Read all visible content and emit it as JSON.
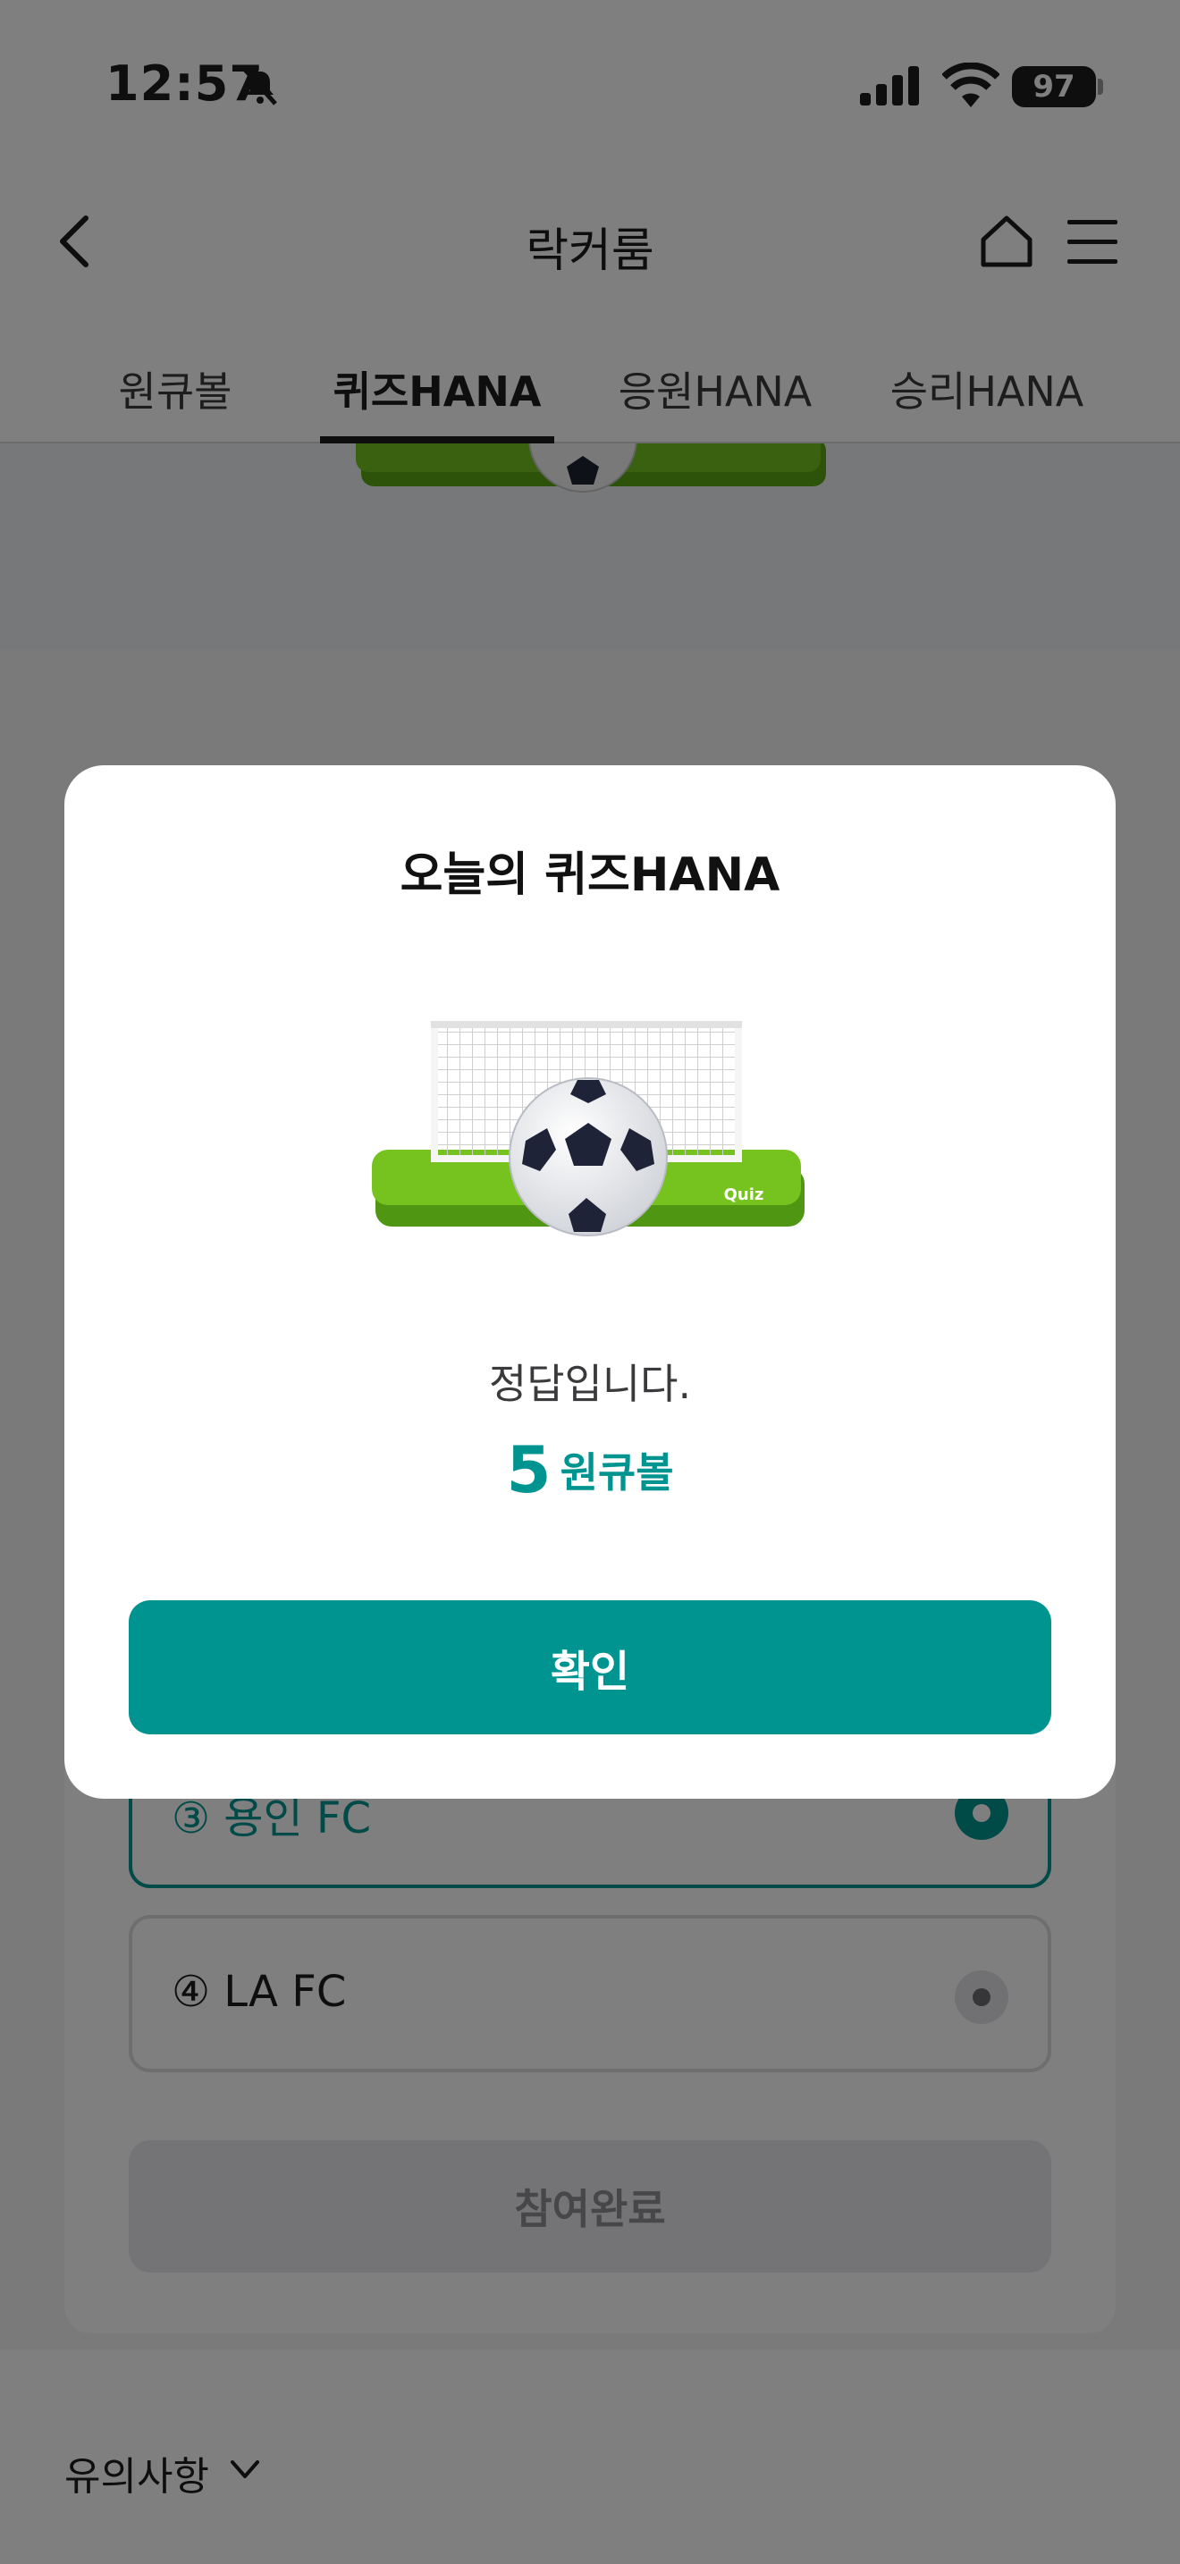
{
  "status_bar": {
    "time": "12:57",
    "battery": "97"
  },
  "header": {
    "title": "락커룸"
  },
  "tabs": [
    {
      "label": "원큐볼"
    },
    {
      "label": "퀴즈HANA"
    },
    {
      "label": "응원HANA"
    },
    {
      "label": "승리HANA"
    }
  ],
  "quiz": {
    "options": [
      {
        "label": "③ 용인 FC",
        "selected": true
      },
      {
        "label": "④ LA FC",
        "selected": false
      }
    ],
    "submit_label": "참여완료"
  },
  "notice": {
    "label": "유의사항"
  },
  "modal": {
    "title": "오늘의 퀴즈HANA",
    "illustration_label": "Quiz",
    "result": "정답입니다.",
    "reward_amount": "5",
    "reward_unit": "원큐볼",
    "confirm_label": "확인"
  },
  "colors": {
    "accent": "#009490",
    "grass": "#6fbe1d"
  }
}
